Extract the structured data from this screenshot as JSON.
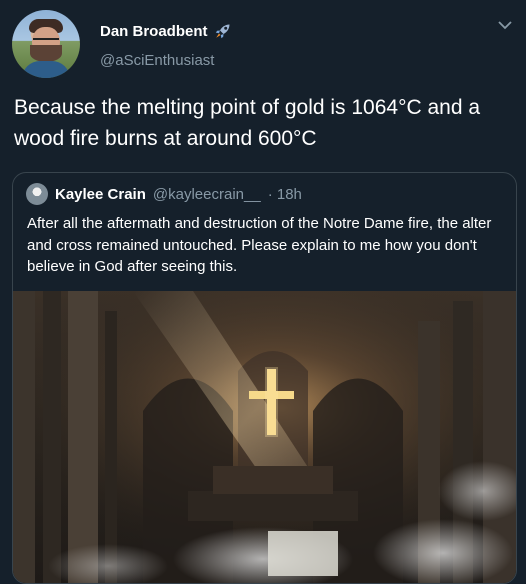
{
  "tweet": {
    "author": {
      "display_name": "Dan Broadbent",
      "handle": "@aSciEnthusiast",
      "badge_icon": "rocket-icon"
    },
    "text": "Because the melting point of gold is 1064°C and a wood fire burns at around 600°C",
    "menu_icon": "chevron-down-icon"
  },
  "quoted_tweet": {
    "author": {
      "display_name": "Kaylee Crain",
      "handle": "@kayleecrain__",
      "time": "· 18h"
    },
    "text": "After all the aftermath and destruction of the Notre Dame fire, the alter and cross remained untouched. Please explain to me how you don't believe in God after seeing this."
  },
  "colors": {
    "background": "#15202b",
    "text_primary": "#ffffff",
    "text_secondary": "#8899a6",
    "border": "#38444d",
    "cross_gold": "#f6d98a"
  }
}
